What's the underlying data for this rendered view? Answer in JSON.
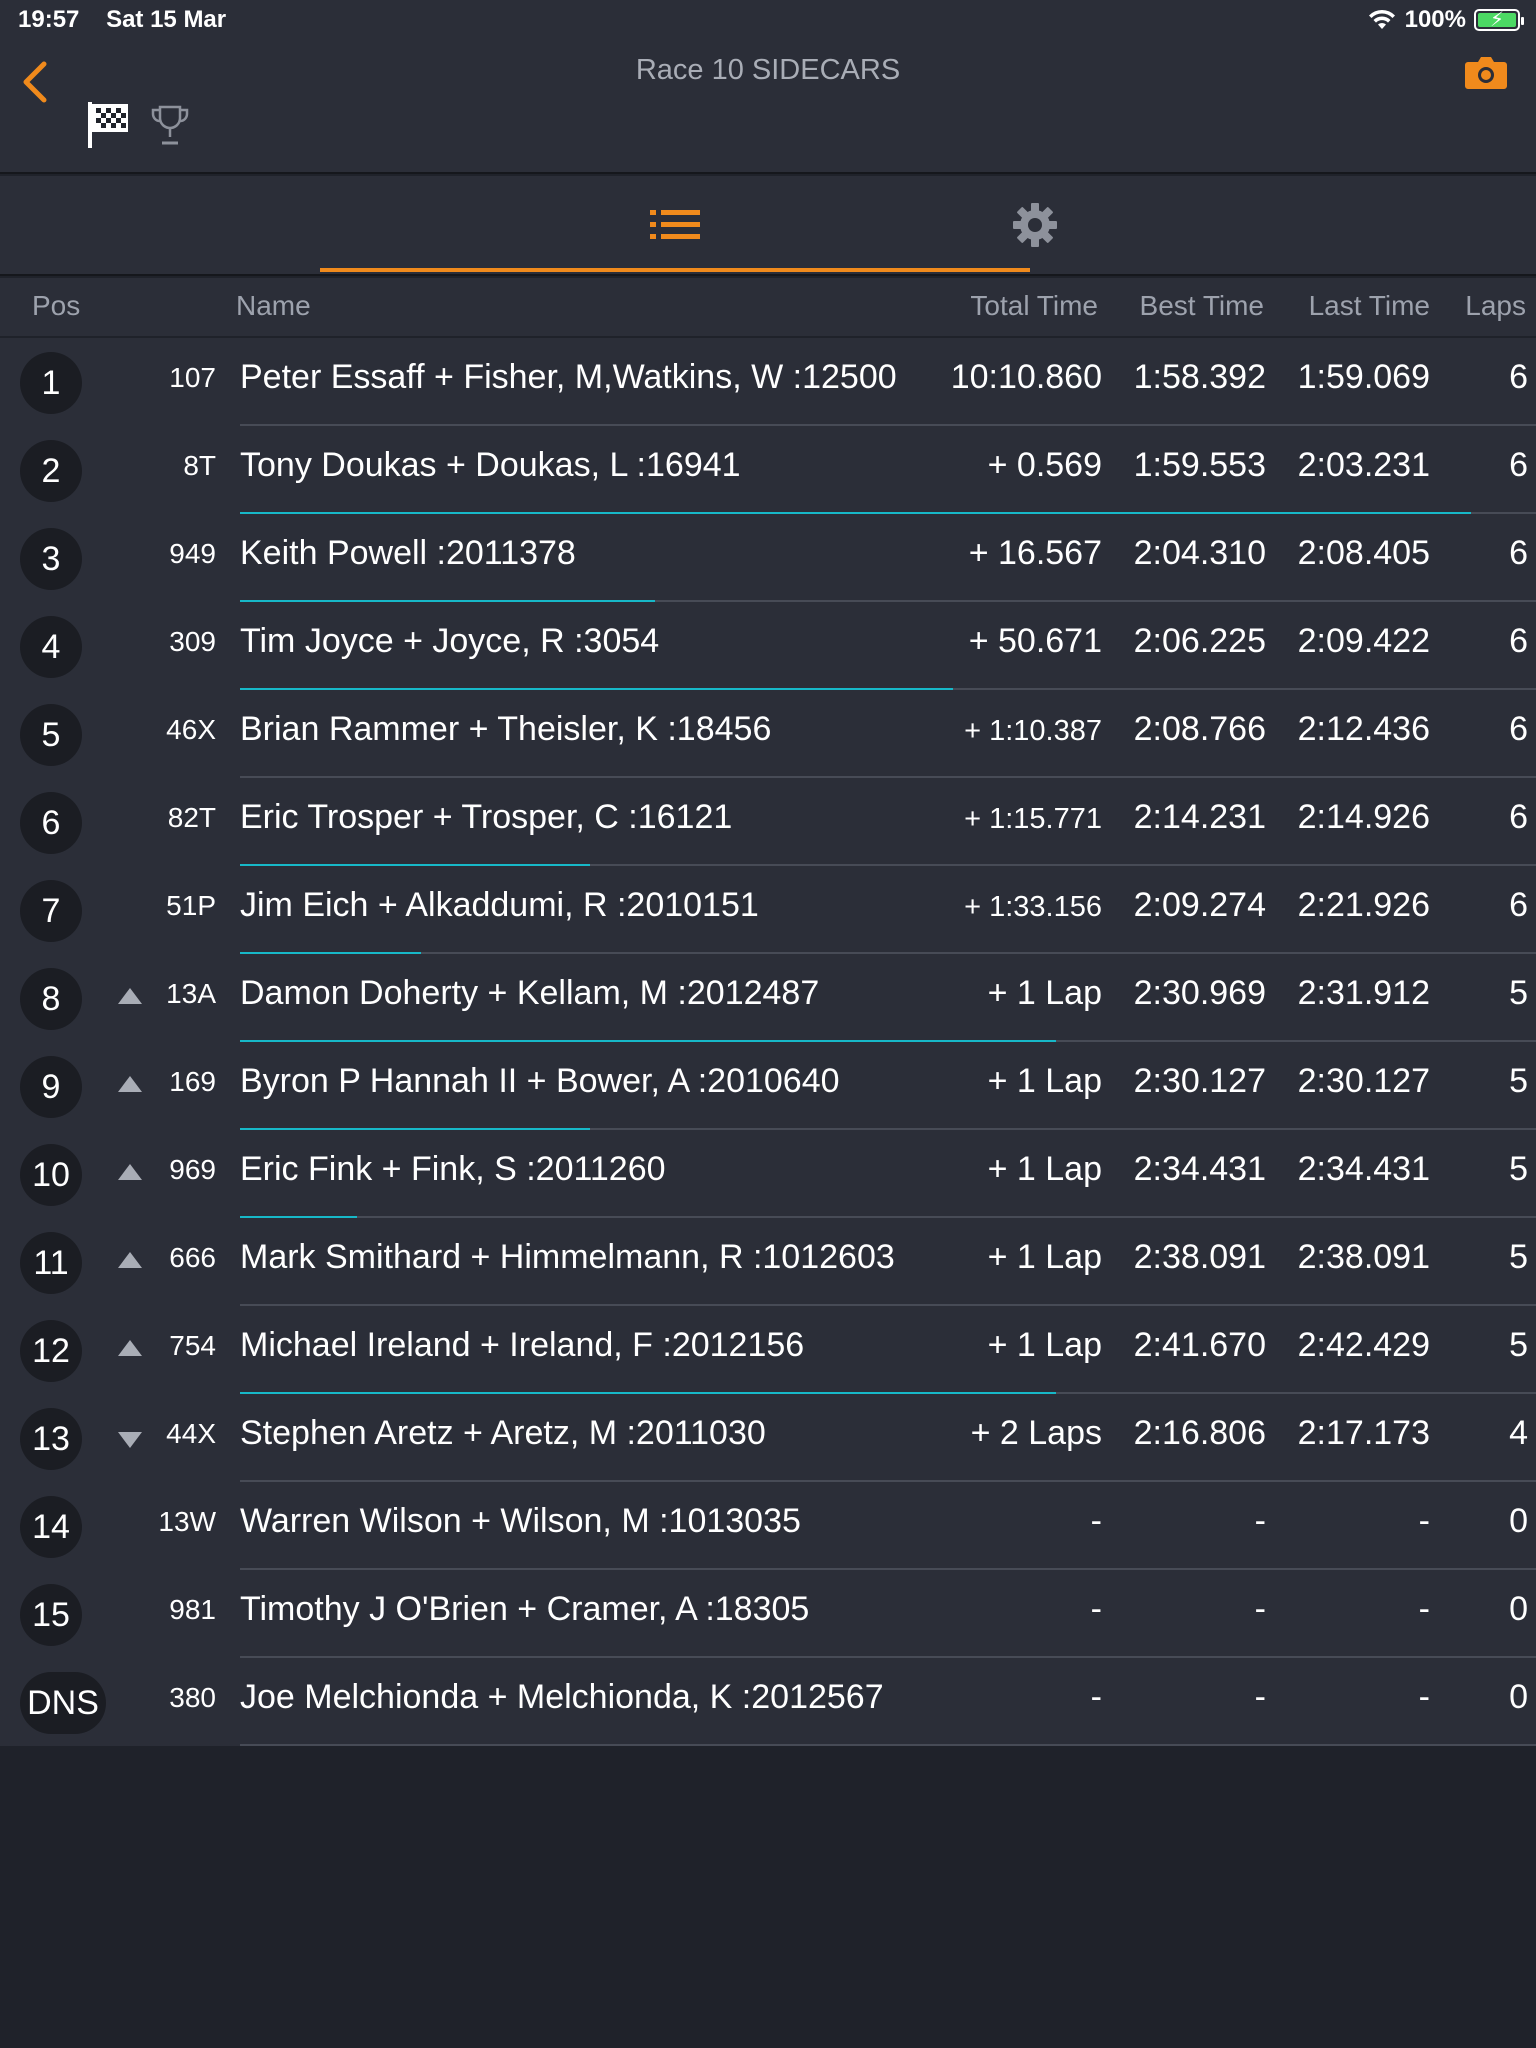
{
  "status": {
    "time": "19:57",
    "date": "Sat 15 Mar",
    "battery": "100%"
  },
  "header": {
    "title": "Race 10 SIDECARS"
  },
  "columns": {
    "pos": "Pos",
    "name": "Name",
    "total": "Total Time",
    "best": "Best Time",
    "last": "Last Time",
    "laps": "Laps"
  },
  "colors": {
    "accent": "#f08a1c",
    "gap_bar": "#17b8c8",
    "background": "#2b2e38"
  },
  "rows": [
    {
      "pos": "1",
      "num": "107",
      "move": "",
      "name": "Peter Essaff + Fisher, M,Watkins, W :12500",
      "total": "10:10.860",
      "best": "1:58.392",
      "last": "1:59.069",
      "laps": "6",
      "gap_fraction": 0
    },
    {
      "pos": "2",
      "num": "8T",
      "move": "",
      "name": "Tony Doukas + Doukas, L :16941",
      "total": "+ 0.569",
      "best": "1:59.553",
      "last": "2:03.231",
      "laps": "6",
      "gap_fraction": 0.95
    },
    {
      "pos": "3",
      "num": "949",
      "move": "",
      "name": "Keith Powell :2011378",
      "total": "+ 16.567",
      "best": "2:04.310",
      "last": "2:08.405",
      "laps": "6",
      "gap_fraction": 0.32
    },
    {
      "pos": "4",
      "num": "309",
      "move": "",
      "name": "Tim Joyce + Joyce, R :3054",
      "total": "+ 50.671",
      "best": "2:06.225",
      "last": "2:09.422",
      "laps": "6",
      "gap_fraction": 0.55
    },
    {
      "pos": "5",
      "num": "46X",
      "move": "",
      "name": "Brian Rammer + Theisler, K :18456",
      "total": "+ 1:10.387",
      "best": "2:08.766",
      "last": "2:12.436",
      "laps": "6",
      "gap_fraction": 0
    },
    {
      "pos": "6",
      "num": "82T",
      "move": "",
      "name": "Eric Trosper + Trosper, C :16121",
      "total": "+ 1:15.771",
      "best": "2:14.231",
      "last": "2:14.926",
      "laps": "6",
      "gap_fraction": 0.27
    },
    {
      "pos": "7",
      "num": "51P",
      "move": "",
      "name": "Jim Eich + Alkaddumi, R :2010151",
      "total": "+ 1:33.156",
      "best": "2:09.274",
      "last": "2:21.926",
      "laps": "6",
      "gap_fraction": 0.14
    },
    {
      "pos": "8",
      "num": "13A",
      "move": "up",
      "name": "Damon Doherty + Kellam, M :2012487",
      "total": "+ 1 Lap",
      "best": "2:30.969",
      "last": "2:31.912",
      "laps": "5",
      "gap_fraction": 0.63
    },
    {
      "pos": "9",
      "num": "169",
      "move": "up",
      "name": "Byron P Hannah II + Bower, A :2010640",
      "total": "+ 1 Lap",
      "best": "2:30.127",
      "last": "2:30.127",
      "laps": "5",
      "gap_fraction": 0.27
    },
    {
      "pos": "10",
      "num": "969",
      "move": "up",
      "name": "Eric Fink + Fink, S :2011260",
      "total": "+ 1 Lap",
      "best": "2:34.431",
      "last": "2:34.431",
      "laps": "5",
      "gap_fraction": 0.09
    },
    {
      "pos": "11",
      "num": "666",
      "move": "up",
      "name": "Mark Smithard + Himmelmann, R :1012603",
      "total": "+ 1 Lap",
      "best": "2:38.091",
      "last": "2:38.091",
      "laps": "5",
      "gap_fraction": 0
    },
    {
      "pos": "12",
      "num": "754",
      "move": "up",
      "name": "Michael Ireland + Ireland, F :2012156",
      "total": "+ 1 Lap",
      "best": "2:41.670",
      "last": "2:42.429",
      "laps": "5",
      "gap_fraction": 0.63
    },
    {
      "pos": "13",
      "num": "44X",
      "move": "down",
      "name": "Stephen Aretz + Aretz, M :2011030",
      "total": "+ 2 Laps",
      "best": "2:16.806",
      "last": "2:17.173",
      "laps": "4",
      "gap_fraction": 0
    },
    {
      "pos": "14",
      "num": "13W",
      "move": "",
      "name": "Warren Wilson + Wilson, M :1013035",
      "total": "-",
      "best": "-",
      "last": "-",
      "laps": "0",
      "gap_fraction": 0
    },
    {
      "pos": "15",
      "num": "981",
      "move": "",
      "name": "Timothy J O'Brien + Cramer, A :18305",
      "total": "-",
      "best": "-",
      "last": "-",
      "laps": "0",
      "gap_fraction": 0
    },
    {
      "pos": "DNS",
      "num": "380",
      "move": "",
      "name": "Joe Melchionda + Melchionda, K :2012567",
      "total": "-",
      "best": "-",
      "last": "-",
      "laps": "0",
      "gap_fraction": 0
    }
  ]
}
